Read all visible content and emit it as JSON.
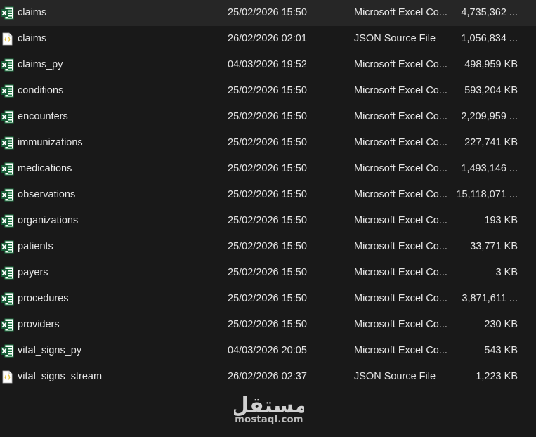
{
  "files": [
    {
      "name": "claims",
      "modified": "25/02/2026 15:50",
      "type": "Microsoft Excel Co...",
      "size": "4,735,362 ...",
      "icon": "excel-file-icon"
    },
    {
      "name": "claims",
      "modified": "26/02/2026 02:01",
      "type": "JSON Source File",
      "size": "1,056,834 ...",
      "icon": "json-file-icon"
    },
    {
      "name": "claims_py",
      "modified": "04/03/2026 19:52",
      "type": "Microsoft Excel Co...",
      "size": "498,959 KB",
      "icon": "excel-file-icon"
    },
    {
      "name": "conditions",
      "modified": "25/02/2026 15:50",
      "type": "Microsoft Excel Co...",
      "size": "593,204 KB",
      "icon": "excel-file-icon"
    },
    {
      "name": "encounters",
      "modified": "25/02/2026 15:50",
      "type": "Microsoft Excel Co...",
      "size": "2,209,959 ...",
      "icon": "excel-file-icon"
    },
    {
      "name": "immunizations",
      "modified": "25/02/2026 15:50",
      "type": "Microsoft Excel Co...",
      "size": "227,741 KB",
      "icon": "excel-file-icon"
    },
    {
      "name": "medications",
      "modified": "25/02/2026 15:50",
      "type": "Microsoft Excel Co...",
      "size": "1,493,146 ...",
      "icon": "excel-file-icon"
    },
    {
      "name": "observations",
      "modified": "25/02/2026 15:50",
      "type": "Microsoft Excel Co...",
      "size": "15,118,071 ...",
      "icon": "excel-file-icon"
    },
    {
      "name": "organizations",
      "modified": "25/02/2026 15:50",
      "type": "Microsoft Excel Co...",
      "size": "193 KB",
      "icon": "excel-file-icon"
    },
    {
      "name": "patients",
      "modified": "25/02/2026 15:50",
      "type": "Microsoft Excel Co...",
      "size": "33,771 KB",
      "icon": "excel-file-icon"
    },
    {
      "name": "payers",
      "modified": "25/02/2026 15:50",
      "type": "Microsoft Excel Co...",
      "size": "3 KB",
      "icon": "excel-file-icon"
    },
    {
      "name": "procedures",
      "modified": "25/02/2026 15:50",
      "type": "Microsoft Excel Co...",
      "size": "3,871,611 ...",
      "icon": "excel-file-icon"
    },
    {
      "name": "providers",
      "modified": "25/02/2026 15:50",
      "type": "Microsoft Excel Co...",
      "size": "230 KB",
      "icon": "excel-file-icon"
    },
    {
      "name": "vital_signs_py",
      "modified": "04/03/2026 20:05",
      "type": "Microsoft Excel Co...",
      "size": "543 KB",
      "icon": "excel-file-icon"
    },
    {
      "name": "vital_signs_stream",
      "modified": "26/02/2026 02:37",
      "type": "JSON Source File",
      "size": "1,223 KB",
      "icon": "json-file-icon"
    }
  ],
  "watermark": {
    "logo_text": "مستقل",
    "text": "mostaql.com"
  },
  "colors": {
    "background": "#191919",
    "text": "#e6e6e6",
    "excel_green": "#1f7a45",
    "excel_dark_green": "#185c37",
    "json_yellow": "#e8c33a",
    "watermark": "#d0d0d0"
  }
}
